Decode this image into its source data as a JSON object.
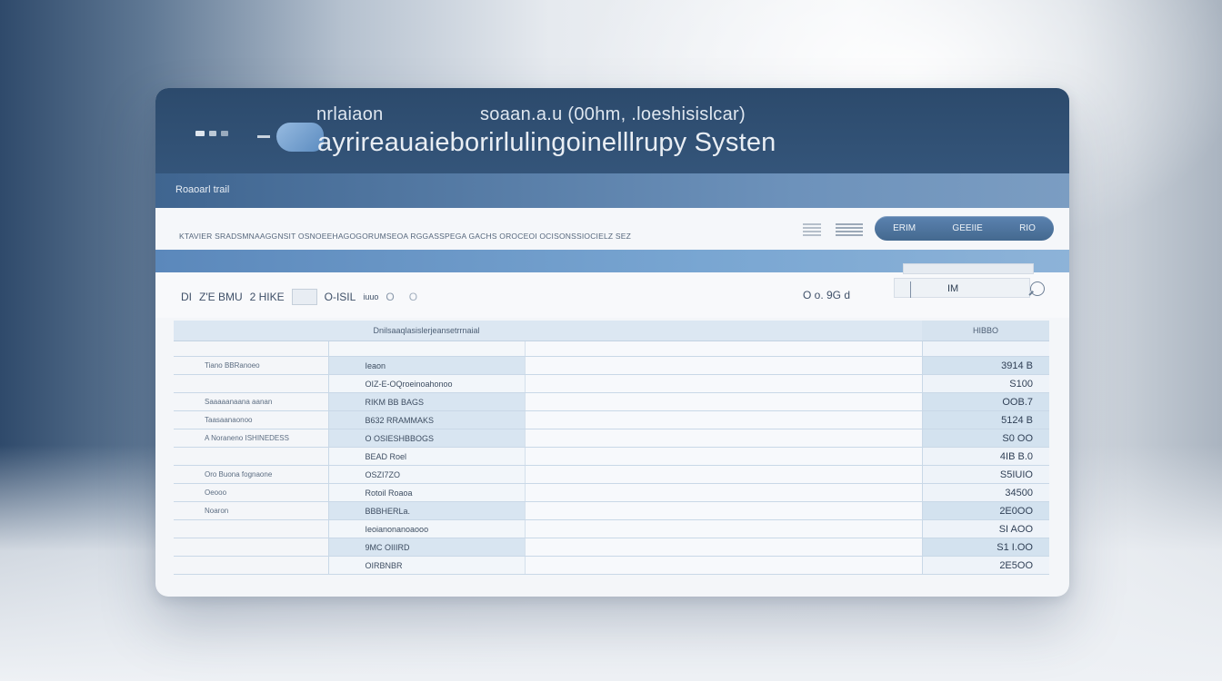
{
  "window": {
    "title_left": "nrlaiaon",
    "title_right": "soaan.a.u (00hm, .loeshisislcar)",
    "title_main": "ayrireauaieborirlulingoinelllrupy Systen"
  },
  "subbar": {
    "label": "Roaoarl trail"
  },
  "toolbar": {
    "path": "KTAVIER SRADSMNAAGGNSIT OSNOEEHAGOGORUMSEOA RGGASSPEGA GACHS OROCEOI OCISONSSIOCIELZ SEZ",
    "buttons": [
      "ERIM",
      "GEEIIE",
      "RIO"
    ]
  },
  "filters": {
    "left_a": "DI",
    "left_b": "Z'E BMU",
    "left_c": "2 HIKE",
    "left_d": "O-ISIL",
    "left_e": "iuuo",
    "left_f": "O",
    "left_g": "O",
    "right": "O  o. 9G d",
    "search_value": "IM"
  },
  "table": {
    "headers": [
      "",
      "Dnilsaaqlasislerjeansetrrnaial",
      "",
      "HIBBO"
    ],
    "rows": [
      {
        "label": "",
        "name": "",
        "value": "",
        "style": "spacer"
      },
      {
        "label": "Tiano BBRanoeo",
        "name": "Ieaon",
        "value": "3914 B",
        "style": "shade"
      },
      {
        "label": "",
        "name": "OIZ-E-OQroeinoahonoo",
        "value": "S100",
        "style": "light"
      },
      {
        "label": "Saaaaanaana aanan",
        "name": "RIKM BB BAGS",
        "value": "OOB.7",
        "style": "shade"
      },
      {
        "label": "Taasaanaonoo",
        "name": "B632 RRAMMAKS",
        "value": "5124 B",
        "style": "shade"
      },
      {
        "label": "A Noraneno ISHINEDESS",
        "name": "O OSIESHBBOGS",
        "value": "S0 OO",
        "style": "shade"
      },
      {
        "label": "",
        "name": "BEAD Roel",
        "value": "4IB B.0",
        "style": "light"
      },
      {
        "label": "Oro Buona fognaone",
        "name": "OSZI7ZO",
        "value": "S5IUIO",
        "style": "light"
      },
      {
        "label": "Oeooo",
        "name": "Rotoil Roaoa",
        "value": "34500",
        "style": "light"
      },
      {
        "label": "Noaron",
        "name": "BBBHERLa.",
        "value": "2E0OO",
        "style": "shade"
      },
      {
        "label": "",
        "name": "Ieoianonanoaooo",
        "value": "SI AOO",
        "style": "light"
      },
      {
        "label": "",
        "name": "9MC OIIIRD",
        "value": "S1 I.OO",
        "style": "shade"
      },
      {
        "label": "",
        "name": "OIRBNBR",
        "value": "2E5OO",
        "style": "light"
      }
    ]
  }
}
